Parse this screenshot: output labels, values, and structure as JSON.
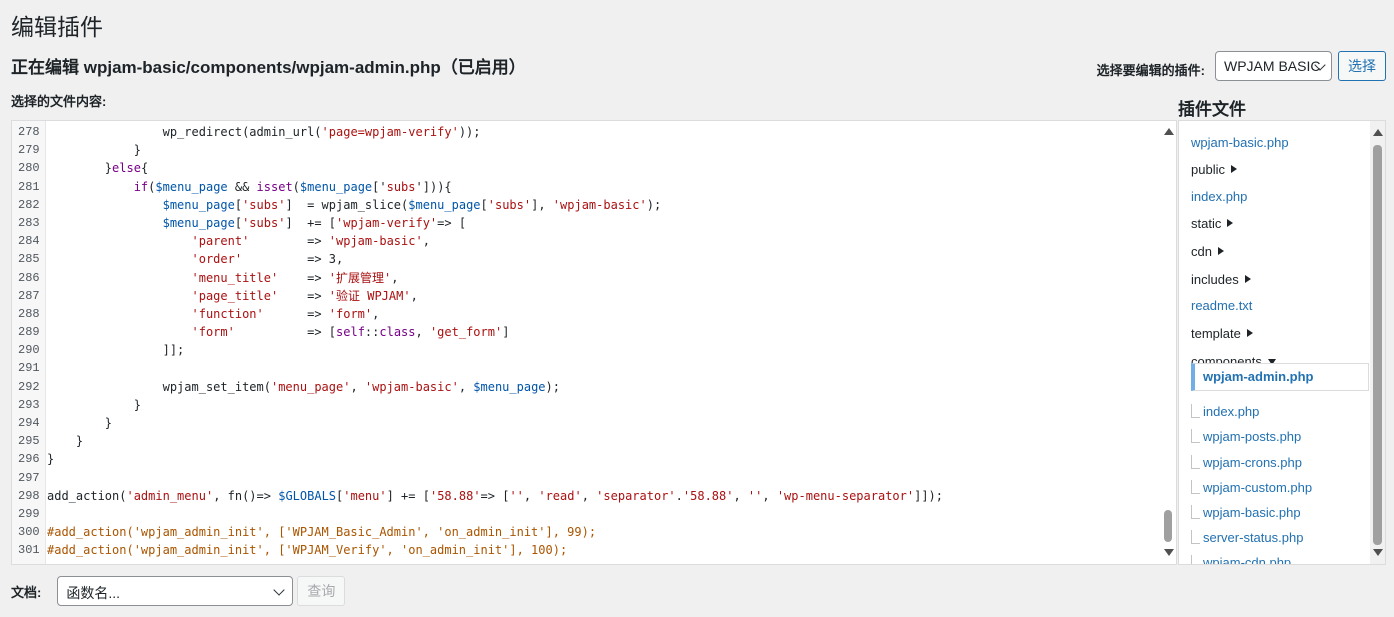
{
  "page_title": "编辑插件",
  "editing": {
    "prefix": "正在编辑",
    "file": "wpjam-basic/components/wpjam-admin.php",
    "status": "（已启用）"
  },
  "select_file_label": "选择的文件内容:",
  "plugin_picker": {
    "label": "选择要编辑的插件:",
    "value": "WPJAM BASIC",
    "button": "选择"
  },
  "files_title": "插件文件",
  "files": [
    {
      "name": "wpjam-basic.php",
      "type": "file"
    },
    {
      "name": "public",
      "type": "folder"
    },
    {
      "name": "index.php",
      "type": "file"
    },
    {
      "name": "static",
      "type": "folder"
    },
    {
      "name": "cdn",
      "type": "folder"
    },
    {
      "name": "includes",
      "type": "folder"
    },
    {
      "name": "readme.txt",
      "type": "file"
    },
    {
      "name": "template",
      "type": "folder"
    },
    {
      "name": "components",
      "type": "folder-open"
    }
  ],
  "component_files": [
    "wpjam-admin.php",
    "index.php",
    "wpjam-posts.php",
    "wpjam-crons.php",
    "wpjam-custom.php",
    "wpjam-basic.php",
    "server-status.php",
    "wpjam-cdn.php"
  ],
  "code_lines": [
    {
      "n": "278",
      "segs": [
        [
          "                wp_redirect(admin_url(",
          "#1d2327"
        ],
        [
          "'page=wpjam-verify'",
          "#a11"
        ],
        [
          "));",
          "#1d2327"
        ]
      ]
    },
    {
      "n": "279",
      "segs": [
        [
          "            }",
          "#1d2327"
        ]
      ]
    },
    {
      "n": "280",
      "segs": [
        [
          "        }",
          "#1d2327"
        ],
        [
          "else",
          "#708"
        ],
        [
          "{",
          "#1d2327"
        ]
      ]
    },
    {
      "n": "281",
      "segs": [
        [
          "            ",
          "#1d2327"
        ],
        [
          "if",
          "#708"
        ],
        [
          "(",
          "#1d2327"
        ],
        [
          "$menu_page",
          "#05a"
        ],
        [
          " && ",
          "#1d2327"
        ],
        [
          "isset",
          "#708"
        ],
        [
          "(",
          "#1d2327"
        ],
        [
          "$menu_page",
          "#05a"
        ],
        [
          "['",
          "#1d2327"
        ],
        [
          "subs",
          "#a11"
        ],
        [
          "'])){",
          "#1d2327"
        ]
      ]
    },
    {
      "n": "282",
      "segs": [
        [
          "                ",
          "#1d2327"
        ],
        [
          "$menu_page",
          "#05a"
        ],
        [
          "[",
          "#1d2327"
        ],
        [
          "'subs'",
          "#a11"
        ],
        [
          "]  = wpjam_slice(",
          "#1d2327"
        ],
        [
          "$menu_page",
          "#05a"
        ],
        [
          "[",
          "#1d2327"
        ],
        [
          "'subs'",
          "#a11"
        ],
        [
          "], ",
          "#1d2327"
        ],
        [
          "'wpjam-basic'",
          "#a11"
        ],
        [
          ");",
          "#1d2327"
        ]
      ]
    },
    {
      "n": "283",
      "segs": [
        [
          "                ",
          "#1d2327"
        ],
        [
          "$menu_page",
          "#05a"
        ],
        [
          "[",
          "#1d2327"
        ],
        [
          "'subs'",
          "#a11"
        ],
        [
          "]  += [",
          "#1d2327"
        ],
        [
          "'wpjam-verify'",
          "#a11"
        ],
        [
          "=> [",
          "#1d2327"
        ]
      ]
    },
    {
      "n": "284",
      "segs": [
        [
          "                    ",
          "#1d2327"
        ],
        [
          "'parent'",
          "#a11"
        ],
        [
          "        => ",
          "#1d2327"
        ],
        [
          "'wpjam-basic'",
          "#a11"
        ],
        [
          ",",
          "#1d2327"
        ]
      ]
    },
    {
      "n": "285",
      "segs": [
        [
          "                    ",
          "#1d2327"
        ],
        [
          "'order'",
          "#a11"
        ],
        [
          "         => 3,",
          "#1d2327"
        ]
      ]
    },
    {
      "n": "286",
      "segs": [
        [
          "                    ",
          "#1d2327"
        ],
        [
          "'menu_title'",
          "#a11"
        ],
        [
          "    => ",
          "#1d2327"
        ],
        [
          "'扩展管理'",
          "#a11"
        ],
        [
          ",",
          "#1d2327"
        ]
      ]
    },
    {
      "n": "287",
      "segs": [
        [
          "                    ",
          "#1d2327"
        ],
        [
          "'page_title'",
          "#a11"
        ],
        [
          "    => ",
          "#1d2327"
        ],
        [
          "'验证 WPJAM'",
          "#a11"
        ],
        [
          ",",
          "#1d2327"
        ]
      ]
    },
    {
      "n": "288",
      "segs": [
        [
          "                    ",
          "#1d2327"
        ],
        [
          "'function'",
          "#a11"
        ],
        [
          "      => ",
          "#1d2327"
        ],
        [
          "'form'",
          "#a11"
        ],
        [
          ",",
          "#1d2327"
        ]
      ]
    },
    {
      "n": "289",
      "segs": [
        [
          "                    ",
          "#1d2327"
        ],
        [
          "'form'",
          "#a11"
        ],
        [
          "          => [",
          "#1d2327"
        ],
        [
          "self",
          "#708"
        ],
        [
          "::",
          "#1d2327"
        ],
        [
          "class",
          "#708"
        ],
        [
          ", ",
          "#1d2327"
        ],
        [
          "'get_form'",
          "#a11"
        ],
        [
          "]",
          "#1d2327"
        ]
      ]
    },
    {
      "n": "290",
      "segs": [
        [
          "                ]];",
          "#1d2327"
        ]
      ]
    },
    {
      "n": "291",
      "segs": [
        [
          "",
          "#1d2327"
        ]
      ]
    },
    {
      "n": "292",
      "segs": [
        [
          "                wpjam_set_item(",
          "#1d2327"
        ],
        [
          "'menu_page'",
          "#a11"
        ],
        [
          ", ",
          "#1d2327"
        ],
        [
          "'wpjam-basic'",
          "#a11"
        ],
        [
          ", ",
          "#1d2327"
        ],
        [
          "$menu_page",
          "#05a"
        ],
        [
          ");",
          "#1d2327"
        ]
      ]
    },
    {
      "n": "293",
      "segs": [
        [
          "            }",
          "#1d2327"
        ]
      ]
    },
    {
      "n": "294",
      "segs": [
        [
          "        }",
          "#1d2327"
        ]
      ]
    },
    {
      "n": "295",
      "segs": [
        [
          "    }",
          "#1d2327"
        ]
      ]
    },
    {
      "n": "296",
      "segs": [
        [
          "}",
          "#1d2327"
        ]
      ]
    },
    {
      "n": "297",
      "segs": [
        [
          "",
          "#1d2327"
        ]
      ]
    },
    {
      "n": "298",
      "segs": [
        [
          "add_action(",
          "#1d2327"
        ],
        [
          "'admin_menu'",
          "#a11"
        ],
        [
          ", fn()=> ",
          "#1d2327"
        ],
        [
          "$GLOBALS",
          "#05a"
        ],
        [
          "[",
          "#1d2327"
        ],
        [
          "'menu'",
          "#a11"
        ],
        [
          "] += [",
          "#1d2327"
        ],
        [
          "'58.88'",
          "#a11"
        ],
        [
          "=> [",
          "#1d2327"
        ],
        [
          "''",
          "#a11"
        ],
        [
          ", ",
          "#1d2327"
        ],
        [
          "'read'",
          "#a11"
        ],
        [
          ", ",
          "#1d2327"
        ],
        [
          "'separator'",
          "#a11"
        ],
        [
          ".",
          "#1d2327"
        ],
        [
          "'58.88'",
          "#a11"
        ],
        [
          ", ",
          "#1d2327"
        ],
        [
          "''",
          "#a11"
        ],
        [
          ", ",
          "#1d2327"
        ],
        [
          "'wp-menu-separator'",
          "#a11"
        ],
        [
          "]]);",
          "#1d2327"
        ]
      ]
    },
    {
      "n": "299",
      "segs": [
        [
          "",
          "#1d2327"
        ]
      ]
    },
    {
      "n": "300",
      "segs": [
        [
          "#add_action('wpjam_admin_init', ['WPJAM_Basic_Admin', 'on_admin_init'], 99);",
          "#a50"
        ]
      ]
    },
    {
      "n": "301",
      "segs": [
        [
          "#add_action('wpjam_admin_init', ['WPJAM_Verify', 'on_admin_init'], 100);",
          "#a50"
        ]
      ]
    }
  ],
  "docs": {
    "label": "文档:",
    "placeholder": "函数名...",
    "button": "查询"
  }
}
